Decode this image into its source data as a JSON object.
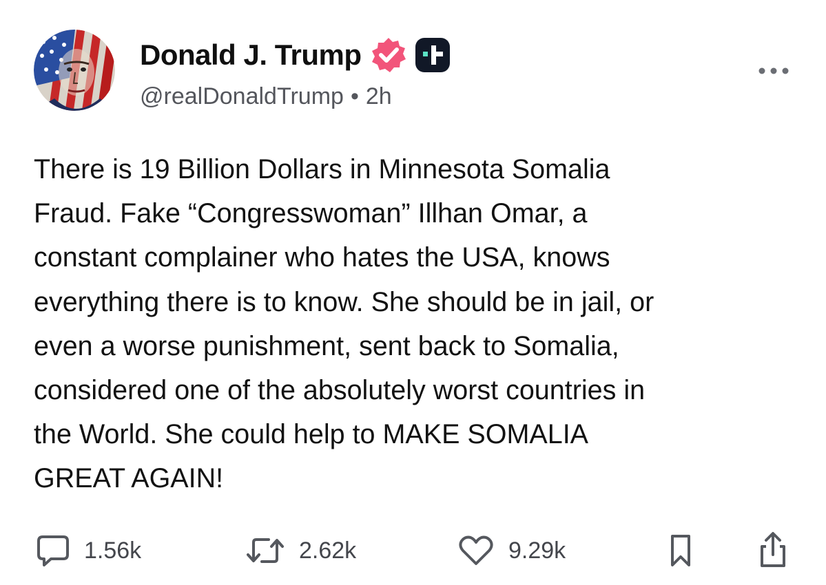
{
  "post": {
    "author_name": "Donald J. Trump",
    "handle": "@realDonaldTrump",
    "separator": "•",
    "time": "2h",
    "text": "There is 19 Billion Dollars in Minnesota Somalia\nFraud. Fake “Congresswoman” Illhan Omar, a\nconstant complainer who hates the USA, knows\neverything there is to know. She should be in jail, or\neven a worse punishment, sent back to Somalia,\nconsidered one of the absolutely worst countries in\nthe World. She could help to MAKE SOMALIA\nGREAT AGAIN!"
  },
  "actions": {
    "replies": "1.56k",
    "retruths": "2.62k",
    "likes": "9.29k"
  },
  "icons": {
    "verified": "verified-badge-icon",
    "platform": "truth-social-icon",
    "more": "more-options-icon",
    "reply": "reply-icon",
    "retruth": "retruth-icon",
    "like": "heart-icon",
    "bookmark": "bookmark-icon",
    "share": "share-icon"
  },
  "colors": {
    "verified": "#f2547a",
    "platform_badge": "#111827",
    "platform_accent": "#5ce1c4",
    "text": "#121212",
    "muted": "#54565c"
  }
}
